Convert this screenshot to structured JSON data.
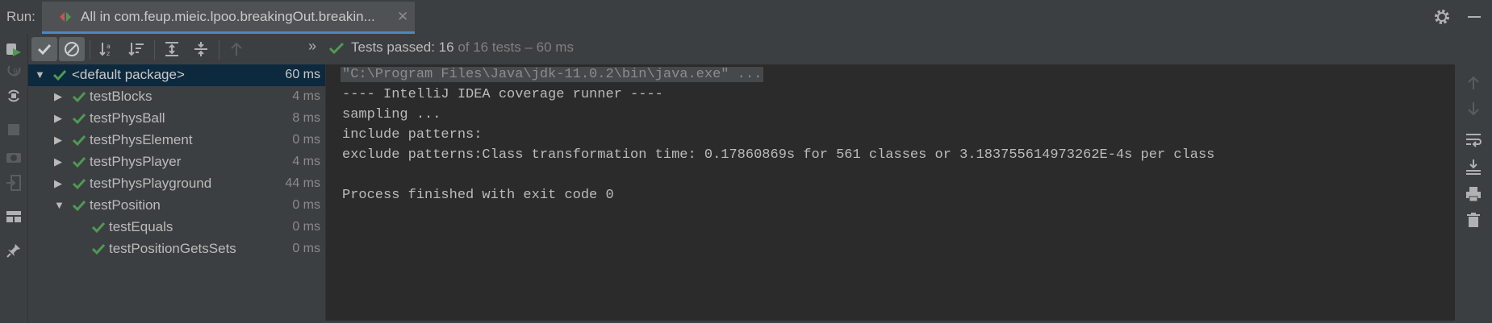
{
  "header": {
    "run_label": "Run:",
    "tab_title": "All in com.feup.mieic.lpoo.breakingOut.breakin...",
    "tab_close": "✕"
  },
  "status": {
    "prefix": "Tests passed: ",
    "passed": "16",
    "of_total": " of 16 tests",
    "duration": " – 60 ms",
    "overflow": "»"
  },
  "tree": [
    {
      "label": "<default package>",
      "duration": "60 ms",
      "expanded": true,
      "selected": true
    },
    {
      "label": "testBlocks",
      "duration": "4 ms"
    },
    {
      "label": "testPhysBall",
      "duration": "8 ms"
    },
    {
      "label": "testPhysElement",
      "duration": "0 ms"
    },
    {
      "label": "testPhysPlayer",
      "duration": "4 ms"
    },
    {
      "label": "testPhysPlayground",
      "duration": "44 ms"
    },
    {
      "label": "testPosition",
      "duration": "0 ms",
      "expanded": true
    },
    {
      "label": "testEquals",
      "duration": "0 ms"
    },
    {
      "label": "testPositionGetsSets",
      "duration": "0 ms"
    }
  ],
  "console": {
    "lines": [
      "\"C:\\Program Files\\Java\\jdk-11.0.2\\bin\\java.exe\" ...",
      "---- IntelliJ IDEA coverage runner ----",
      "sampling ...",
      "include patterns:",
      "exclude patterns:Class transformation time: 0.17860869s for 561 classes or 3.183755614973262E-4s per class",
      "",
      "Process finished with exit code 0"
    ]
  },
  "colors": {
    "pass_green": "#4e9a54",
    "accent_blue": "#4a88c7",
    "panel_bg": "#3c3f41",
    "console_bg": "#2b2b2b",
    "selection_bg": "#0d293e"
  },
  "icons": {
    "left_toolbar": [
      "rerun-icon",
      "rerun-failed-icon",
      "toggle-auto-test-icon",
      "stop-icon",
      "camera-icon",
      "import-tests-icon",
      "layout-icon",
      "pin-icon"
    ],
    "test_toolbar": [
      "show-passed-icon",
      "show-ignored-icon",
      "sort-alphabetically-icon",
      "sort-by-duration-icon",
      "expand-all-icon",
      "collapse-all-icon",
      "previous-failed-icon"
    ],
    "right_toolbar": [
      "up-arrow-icon",
      "down-arrow-icon",
      "soft-wrap-icon",
      "scroll-to-end-icon",
      "print-icon",
      "trash-icon"
    ]
  }
}
